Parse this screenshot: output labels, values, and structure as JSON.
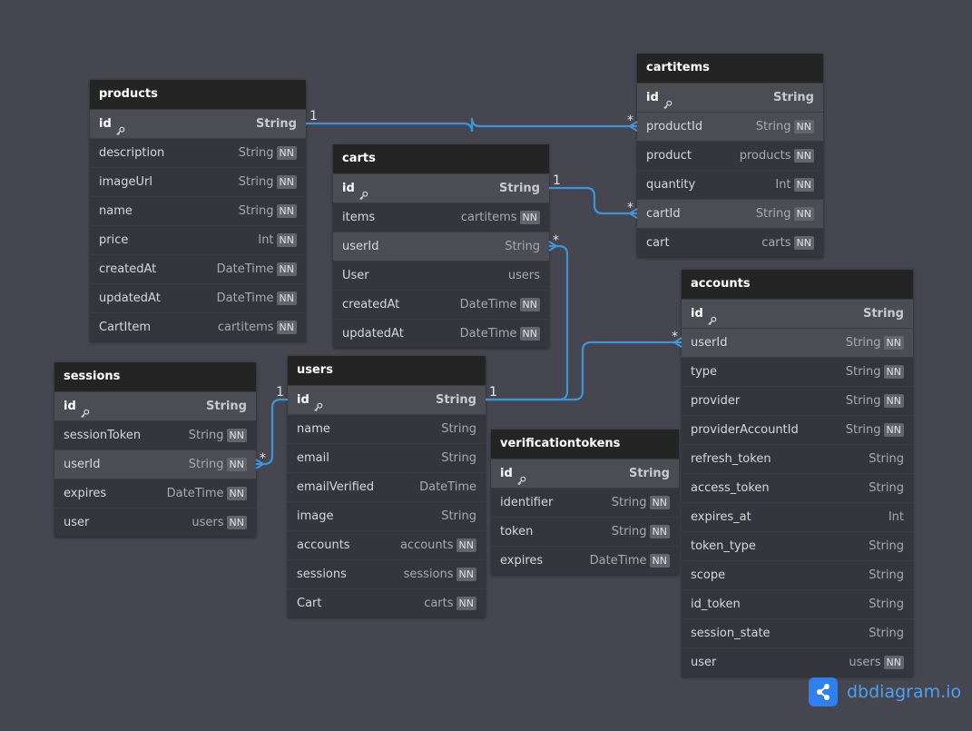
{
  "tables": [
    {
      "id": "products",
      "name": "products",
      "fields": [
        {
          "name": "id",
          "type": "String",
          "pk": true
        },
        {
          "name": "description",
          "type": "String",
          "nn": true
        },
        {
          "name": "imageUrl",
          "type": "String",
          "nn": true
        },
        {
          "name": "name",
          "type": "String",
          "nn": true
        },
        {
          "name": "price",
          "type": "Int",
          "nn": true
        },
        {
          "name": "createdAt",
          "type": "DateTime",
          "nn": true
        },
        {
          "name": "updatedAt",
          "type": "DateTime",
          "nn": true
        },
        {
          "name": "CartItem",
          "type": "cartitems",
          "nn": true
        }
      ]
    },
    {
      "id": "cartitems",
      "name": "cartitems",
      "fields": [
        {
          "name": "id",
          "type": "String",
          "pk": true
        },
        {
          "name": "productId",
          "type": "String",
          "nn": true,
          "hl": true
        },
        {
          "name": "product",
          "type": "products",
          "nn": true
        },
        {
          "name": "quantity",
          "type": "Int",
          "nn": true
        },
        {
          "name": "cartId",
          "type": "String",
          "nn": true,
          "hl": true
        },
        {
          "name": "cart",
          "type": "carts",
          "nn": true
        }
      ]
    },
    {
      "id": "carts",
      "name": "carts",
      "fields": [
        {
          "name": "id",
          "type": "String",
          "pk": true
        },
        {
          "name": "items",
          "type": "cartitems",
          "nn": true
        },
        {
          "name": "userId",
          "type": "String",
          "hl": true
        },
        {
          "name": "User",
          "type": "users"
        },
        {
          "name": "createdAt",
          "type": "DateTime",
          "nn": true
        },
        {
          "name": "updatedAt",
          "type": "DateTime",
          "nn": true
        }
      ]
    },
    {
      "id": "accounts",
      "name": "accounts",
      "fields": [
        {
          "name": "id",
          "type": "String",
          "pk": true
        },
        {
          "name": "userId",
          "type": "String",
          "nn": true,
          "hl": true
        },
        {
          "name": "type",
          "type": "String",
          "nn": true
        },
        {
          "name": "provider",
          "type": "String",
          "nn": true
        },
        {
          "name": "providerAccountId",
          "type": "String",
          "nn": true
        },
        {
          "name": "refresh_token",
          "type": "String"
        },
        {
          "name": "access_token",
          "type": "String"
        },
        {
          "name": "expires_at",
          "type": "Int"
        },
        {
          "name": "token_type",
          "type": "String"
        },
        {
          "name": "scope",
          "type": "String"
        },
        {
          "name": "id_token",
          "type": "String"
        },
        {
          "name": "session_state",
          "type": "String"
        },
        {
          "name": "user",
          "type": "users",
          "nn": true
        }
      ]
    },
    {
      "id": "sessions",
      "name": "sessions",
      "fields": [
        {
          "name": "id",
          "type": "String",
          "pk": true
        },
        {
          "name": "sessionToken",
          "type": "String",
          "nn": true
        },
        {
          "name": "userId",
          "type": "String",
          "nn": true,
          "hl": true
        },
        {
          "name": "expires",
          "type": "DateTime",
          "nn": true
        },
        {
          "name": "user",
          "type": "users",
          "nn": true
        }
      ]
    },
    {
      "id": "users",
      "name": "users",
      "fields": [
        {
          "name": "id",
          "type": "String",
          "pk": true
        },
        {
          "name": "name",
          "type": "String"
        },
        {
          "name": "email",
          "type": "String"
        },
        {
          "name": "emailVerified",
          "type": "DateTime"
        },
        {
          "name": "image",
          "type": "String"
        },
        {
          "name": "accounts",
          "type": "accounts",
          "nn": true
        },
        {
          "name": "sessions",
          "type": "sessions",
          "nn": true
        },
        {
          "name": "Cart",
          "type": "carts",
          "nn": true
        }
      ]
    },
    {
      "id": "verificationtokens",
      "name": "verificationtokens",
      "fields": [
        {
          "name": "id",
          "type": "String",
          "pk": true
        },
        {
          "name": "identifier",
          "type": "String",
          "nn": true
        },
        {
          "name": "token",
          "type": "String",
          "nn": true
        },
        {
          "name": "expires",
          "type": "DateTime",
          "nn": true
        }
      ]
    }
  ],
  "nn_label": "NN",
  "relationships": [
    {
      "from": "products.id",
      "from_card": "1",
      "to": "cartitems.productId",
      "to_card": "*"
    },
    {
      "from": "carts.id",
      "from_card": "1",
      "to": "cartitems.cartId",
      "to_card": "*"
    },
    {
      "from": "users.id",
      "from_card": "1",
      "to": "carts.userId",
      "to_card": "*"
    },
    {
      "from": "users.id",
      "from_card": "1",
      "to": "accounts.userId",
      "to_card": "*"
    },
    {
      "from": "users.id",
      "from_card": "1",
      "to": "sessions.userId",
      "to_card": "*"
    }
  ],
  "colors": {
    "canvas": "#45464f",
    "table_body": "#35363d",
    "table_header": "#242425",
    "highlight_row": "#4b4c54",
    "link": "#3d95d8",
    "brand": "#2f80ed"
  },
  "icons": {
    "primary_key": "key-icon",
    "brand": "share-network-icon"
  },
  "brand": {
    "text": "dbdiagram.io"
  }
}
